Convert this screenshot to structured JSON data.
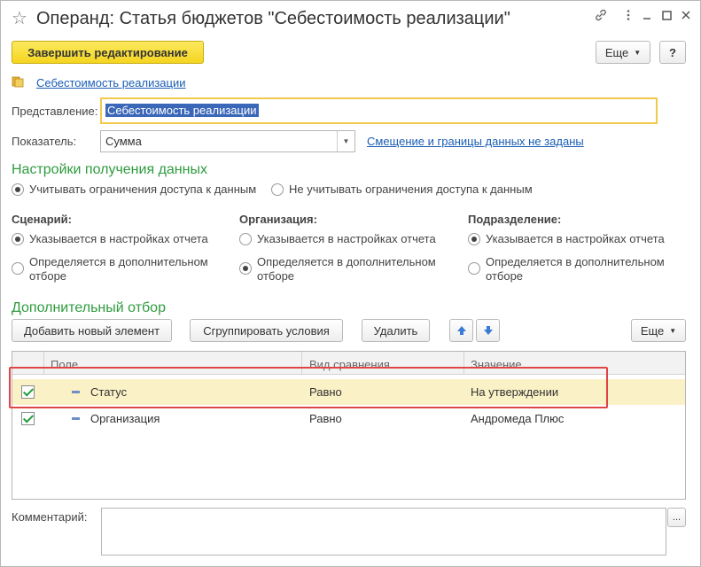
{
  "window": {
    "title": "Операнд: Статья бюджетов \"Себестоимость реализации\""
  },
  "toolbar": {
    "finish_label": "Завершить редактирование",
    "more_label": "Еще",
    "help_label": "?"
  },
  "source_link": "Себестоимость реализации",
  "form": {
    "representation_label": "Представление:",
    "representation_value": "Себестоимость реализации",
    "indicator_label": "Показатель:",
    "indicator_value": "Сумма",
    "offset_link": "Смещение и границы данных не заданы"
  },
  "data_settings": {
    "title": "Настройки получения данных",
    "option_consider": "Учитывать ограничения доступа к данным",
    "option_ignore": "Не  учитывать ограничения доступа к данным"
  },
  "groups": [
    {
      "label": "Сценарий:",
      "option1": "Указывается в настройках отчета",
      "option2_line1": "Определяется в дополнительном",
      "option2_line2": "отборе"
    },
    {
      "label": "Организация:",
      "option1": "Указывается в настройках отчета",
      "option2_line1": "Определяется в дополнительном",
      "option2_line2": "отборе"
    },
    {
      "label": "Подразделение:",
      "option1": "Указывается в настройках отчета",
      "option2_line1": "Определяется в дополнительном",
      "option2_line2": "отборе"
    }
  ],
  "filter": {
    "title": "Дополнительный отбор",
    "add_label": "Добавить новый элемент",
    "group_label": "Сгруппировать условия",
    "delete_label": "Удалить",
    "more_label": "Еще",
    "columns": [
      "Поле",
      "Вид сравнения",
      "Значение"
    ],
    "rows": [
      {
        "field": "Статус",
        "comparison": "Равно",
        "value": "На утверждении"
      },
      {
        "field": "Организация",
        "comparison": "Равно",
        "value": "Андромеда Плюс"
      }
    ]
  },
  "comment": {
    "label": "Комментарий:",
    "more_label": "..."
  },
  "icons": [
    "star-icon",
    "link-icon",
    "more-vertical-icon",
    "minimize-icon",
    "maximize-icon",
    "close-icon",
    "folder-icon",
    "dropdown-arrow-icon",
    "arrow-up-icon",
    "arrow-down-icon"
  ]
}
